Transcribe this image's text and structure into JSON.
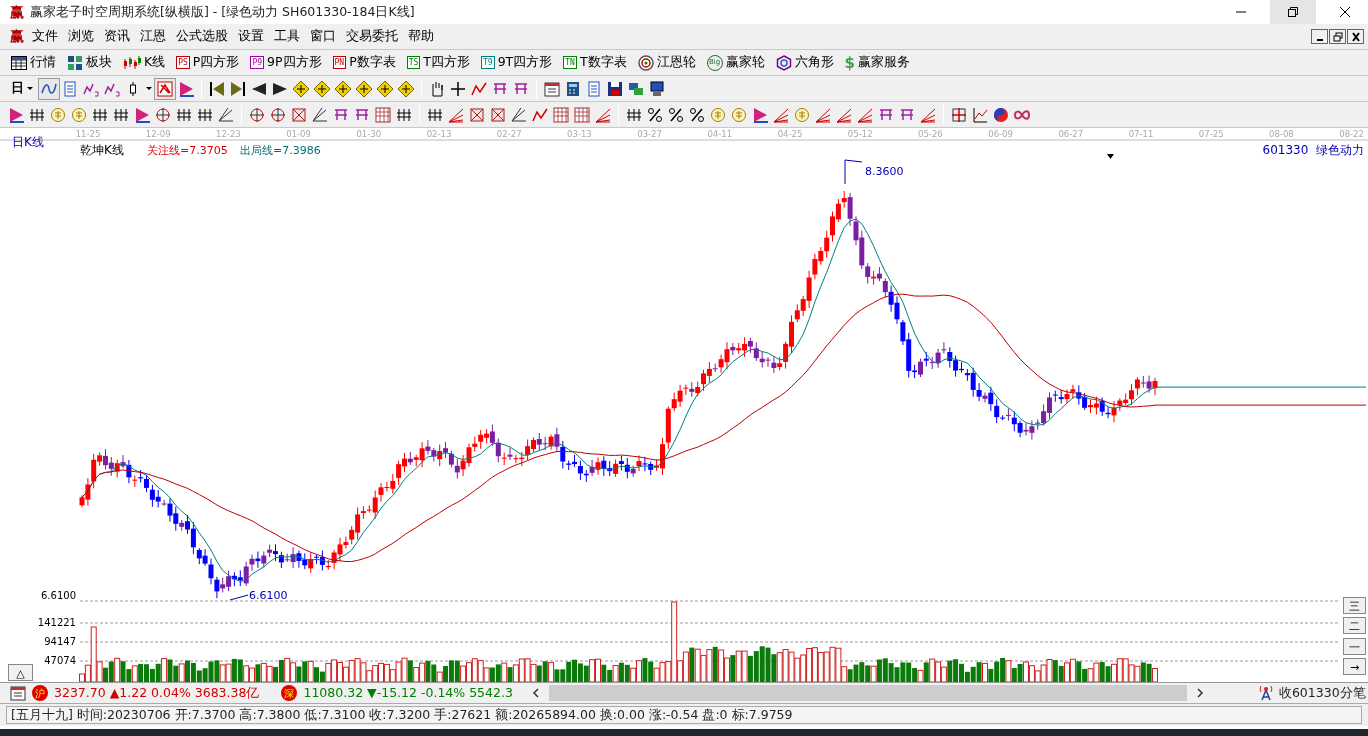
{
  "window": {
    "logo": "赢",
    "title": "赢家老子时空周期系统[纵横版] - [绿色动力  SH601330-184日K线]"
  },
  "menu": {
    "logo": "赢",
    "items": [
      "文件",
      "浏览",
      "资讯",
      "江恩",
      "公式选股",
      "设置",
      "工具",
      "窗口",
      "交易委托",
      "帮助"
    ]
  },
  "toolbar": [
    {
      "label": "行情",
      "kind": "table"
    },
    {
      "label": "板块",
      "kind": "blocks"
    },
    {
      "label": "K线",
      "kind": "candles"
    },
    {
      "label": "P四方形",
      "kind": "tag",
      "tag": "PS",
      "color": "#c00000"
    },
    {
      "label": "9P四方形",
      "kind": "tag",
      "tag": "P9",
      "color": "#a000a0"
    },
    {
      "label": "P数字表",
      "kind": "tag",
      "tag": "PN",
      "color": "#c00000"
    },
    {
      "label": "T四方形",
      "kind": "tag",
      "tag": "TS",
      "color": "#008000"
    },
    {
      "label": "9T四方形",
      "kind": "tag",
      "tag": "T9",
      "color": "#008080"
    },
    {
      "label": "T数字表",
      "kind": "tag",
      "tag": "TN",
      "color": "#008000"
    },
    {
      "label": "江恩轮",
      "kind": "target"
    },
    {
      "label": "赢家轮",
      "kind": "round",
      "tag": "Big"
    },
    {
      "label": "六角形",
      "kind": "hexagon"
    },
    {
      "label": "赢家服务",
      "kind": "dollar",
      "tag": "$"
    }
  ],
  "period": "日",
  "chart": {
    "title": "日K线",
    "indicator": "乾坤K线",
    "watch_line": "关注线=7.3705",
    "exit_line": "出局线=7.3986",
    "stock": "601330  绿色动力",
    "dates": [
      "11-25",
      "12-09",
      "12-23",
      "01-09",
      "01-30",
      "02-13",
      "02-27",
      "03-13",
      "03-27",
      "04-11",
      "04-25",
      "05-12",
      "05-26",
      "06-09",
      "06-27",
      "07-11",
      "07-25",
      "08-08",
      "08-22"
    ],
    "high_label": "8.3600",
    "low_label": "6.6100",
    "price_axis": "6.6100",
    "volume_axis": [
      "141221",
      "94147",
      "47074"
    ],
    "side_buttons": [
      "三",
      "二",
      "一",
      "→"
    ],
    "collapse_button": "△"
  },
  "index_bar": [
    {
      "badge": "沪",
      "text": "3237.70 ▲1.22 0.04% 3683.38亿",
      "rising": true
    },
    {
      "badge": "深",
      "text": "11080.32 ▼-15.12 -0.14% 5542.3",
      "rising": false
    }
  ],
  "receive_label": "收601330分笔",
  "status": "[五月十九] 时间:20230706 开:7.3700 高:7.3800 低:7.3100 收:7.3200 手:27621 额:20265894.00 换:0.00 涨:-0.54 盘:0 标:7.9759"
}
